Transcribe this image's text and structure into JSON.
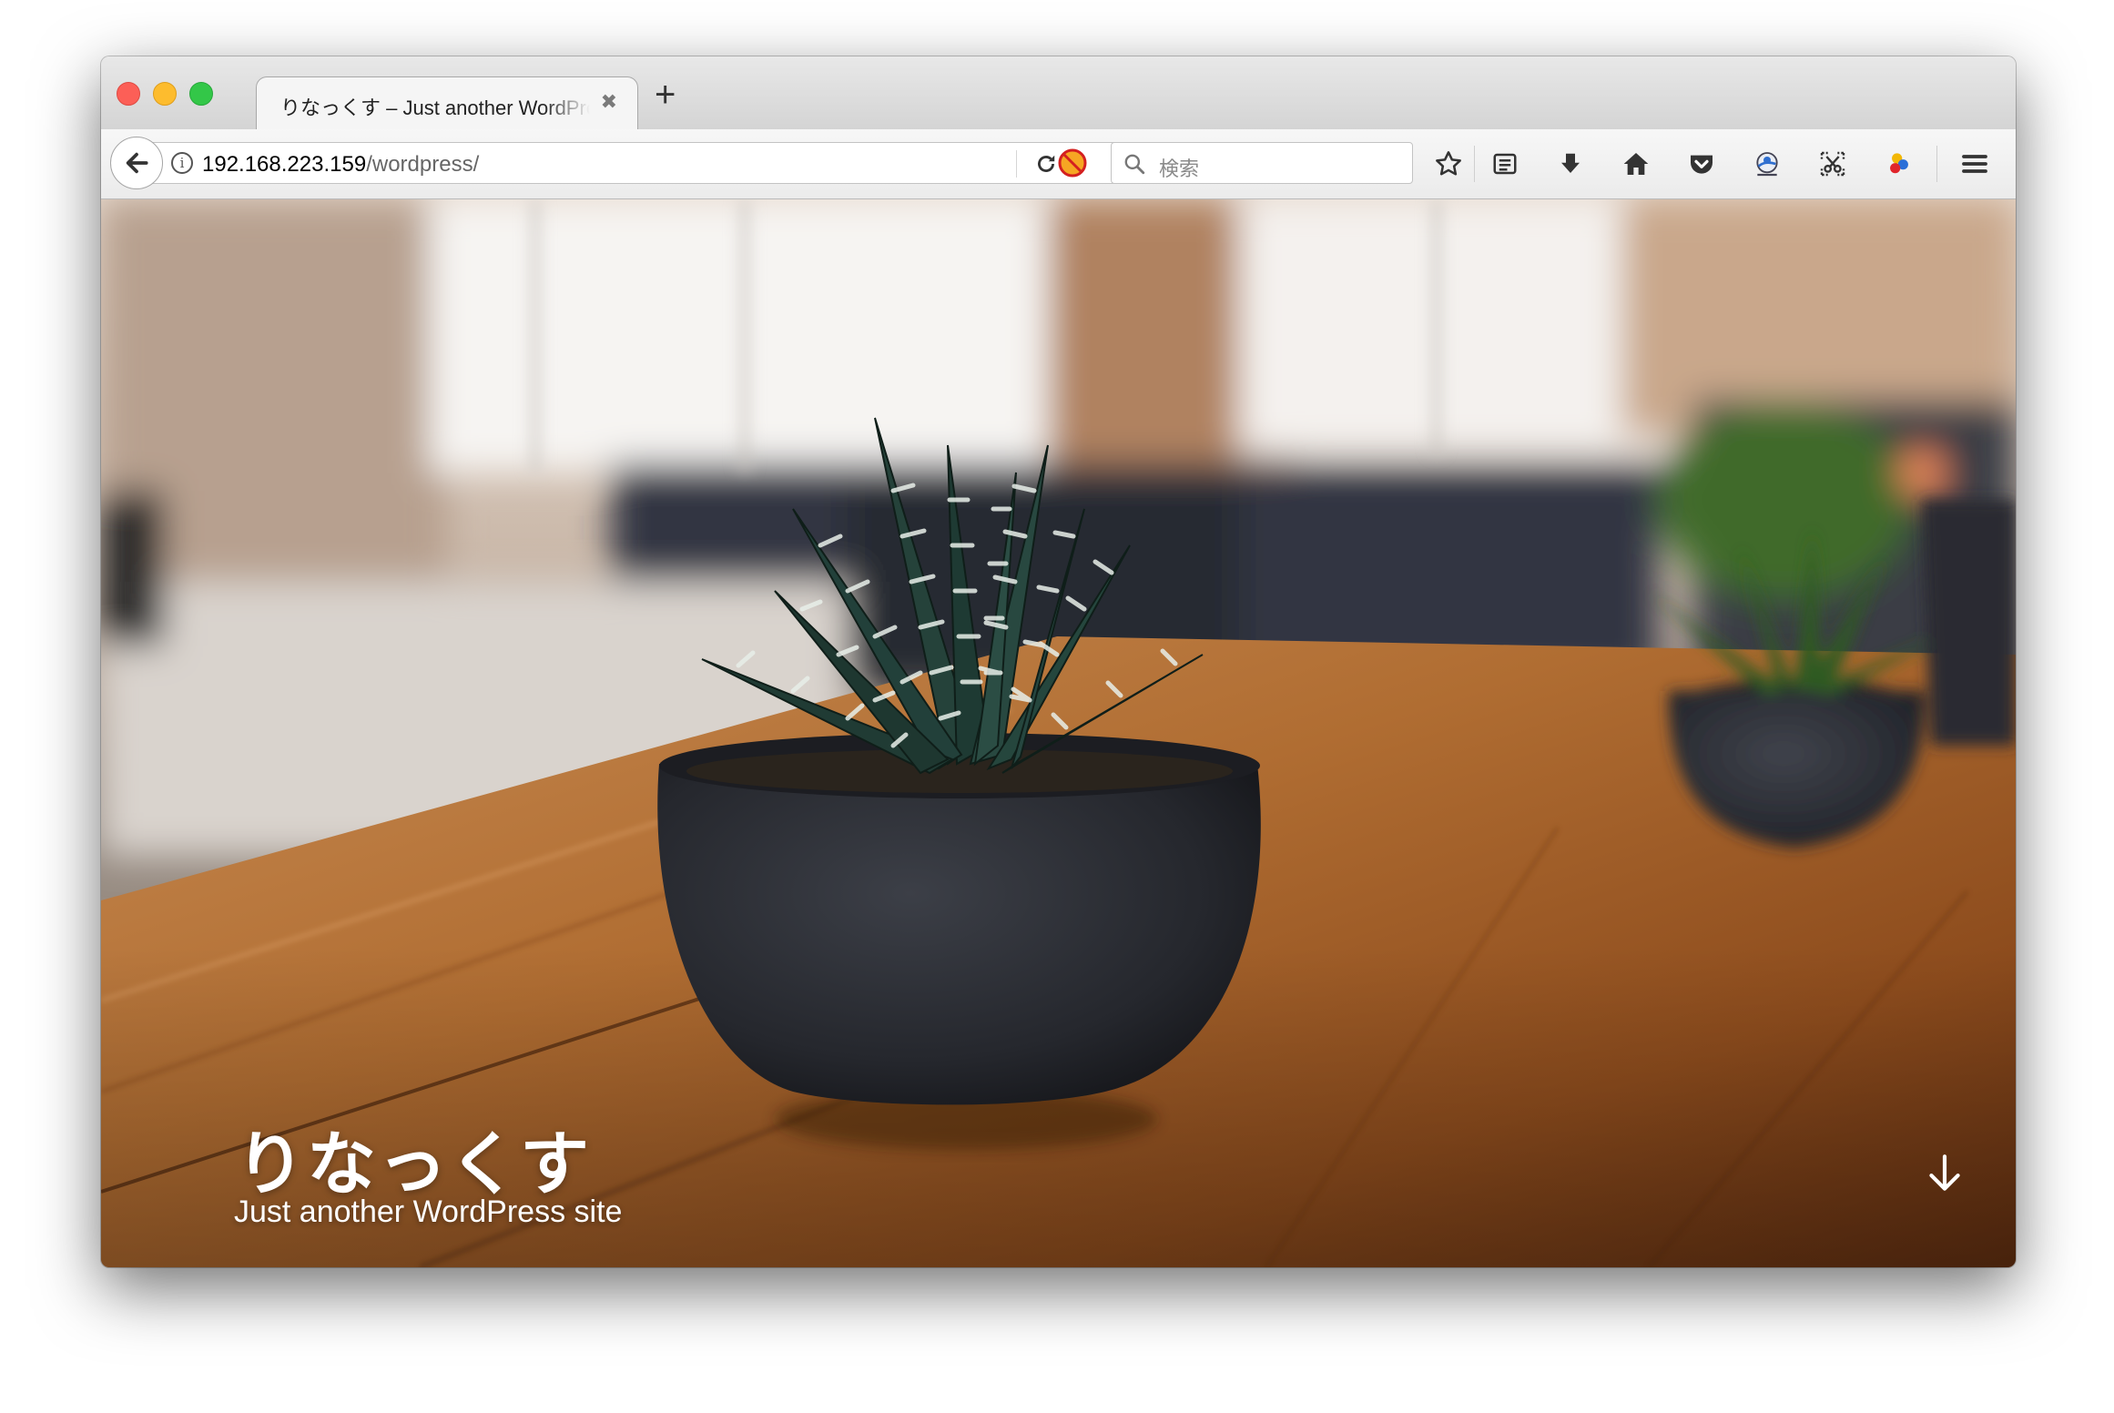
{
  "tab": {
    "title": "りなっくす – Just another WordPress site"
  },
  "address": {
    "host": "192.168.223.159",
    "path": "/wordpress/"
  },
  "search": {
    "placeholder": "検索"
  },
  "site": {
    "title": "りなっくす",
    "description": "Just another WordPress site"
  },
  "colors": {
    "close": "#fc5f57",
    "minimize": "#fdbc2e",
    "maximize": "#33c748",
    "wood": "#a8652a",
    "pot": "#2b2d33"
  },
  "icons": [
    "back-arrow-icon",
    "info-icon",
    "reload-icon",
    "blocked-extension-icon",
    "search-icon",
    "bookmark-star-icon",
    "reading-list-icon",
    "download-icon",
    "home-icon",
    "pocket-icon",
    "globe-extension-icon",
    "screenshot-extension-icon",
    "color-extension-icon",
    "hamburger-menu-icon",
    "scroll-down-arrow-icon"
  ]
}
